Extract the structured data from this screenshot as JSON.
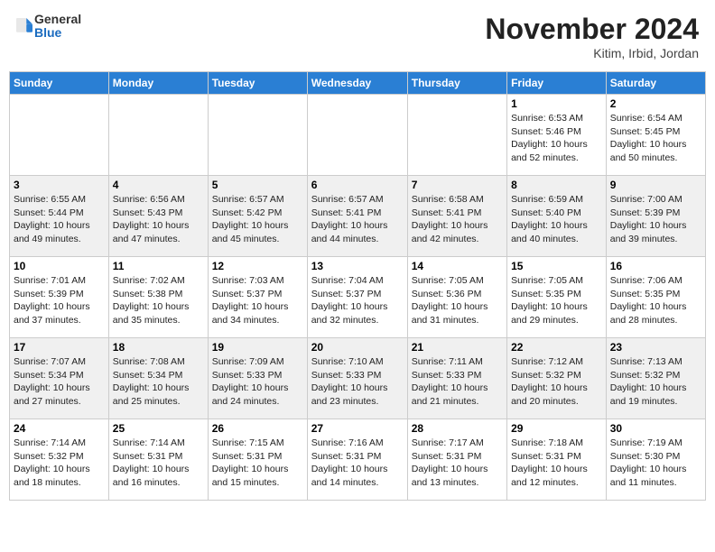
{
  "header": {
    "logo": {
      "general": "General",
      "blue": "Blue"
    },
    "title": "November 2024",
    "location": "Kitim, Irbid, Jordan"
  },
  "weekdays": [
    "Sunday",
    "Monday",
    "Tuesday",
    "Wednesday",
    "Thursday",
    "Friday",
    "Saturday"
  ],
  "weeks": [
    [
      {
        "day": "",
        "info": ""
      },
      {
        "day": "",
        "info": ""
      },
      {
        "day": "",
        "info": ""
      },
      {
        "day": "",
        "info": ""
      },
      {
        "day": "",
        "info": ""
      },
      {
        "day": "1",
        "info": "Sunrise: 6:53 AM\nSunset: 5:46 PM\nDaylight: 10 hours and 52 minutes."
      },
      {
        "day": "2",
        "info": "Sunrise: 6:54 AM\nSunset: 5:45 PM\nDaylight: 10 hours and 50 minutes."
      }
    ],
    [
      {
        "day": "3",
        "info": "Sunrise: 6:55 AM\nSunset: 5:44 PM\nDaylight: 10 hours and 49 minutes."
      },
      {
        "day": "4",
        "info": "Sunrise: 6:56 AM\nSunset: 5:43 PM\nDaylight: 10 hours and 47 minutes."
      },
      {
        "day": "5",
        "info": "Sunrise: 6:57 AM\nSunset: 5:42 PM\nDaylight: 10 hours and 45 minutes."
      },
      {
        "day": "6",
        "info": "Sunrise: 6:57 AM\nSunset: 5:41 PM\nDaylight: 10 hours and 44 minutes."
      },
      {
        "day": "7",
        "info": "Sunrise: 6:58 AM\nSunset: 5:41 PM\nDaylight: 10 hours and 42 minutes."
      },
      {
        "day": "8",
        "info": "Sunrise: 6:59 AM\nSunset: 5:40 PM\nDaylight: 10 hours and 40 minutes."
      },
      {
        "day": "9",
        "info": "Sunrise: 7:00 AM\nSunset: 5:39 PM\nDaylight: 10 hours and 39 minutes."
      }
    ],
    [
      {
        "day": "10",
        "info": "Sunrise: 7:01 AM\nSunset: 5:39 PM\nDaylight: 10 hours and 37 minutes."
      },
      {
        "day": "11",
        "info": "Sunrise: 7:02 AM\nSunset: 5:38 PM\nDaylight: 10 hours and 35 minutes."
      },
      {
        "day": "12",
        "info": "Sunrise: 7:03 AM\nSunset: 5:37 PM\nDaylight: 10 hours and 34 minutes."
      },
      {
        "day": "13",
        "info": "Sunrise: 7:04 AM\nSunset: 5:37 PM\nDaylight: 10 hours and 32 minutes."
      },
      {
        "day": "14",
        "info": "Sunrise: 7:05 AM\nSunset: 5:36 PM\nDaylight: 10 hours and 31 minutes."
      },
      {
        "day": "15",
        "info": "Sunrise: 7:05 AM\nSunset: 5:35 PM\nDaylight: 10 hours and 29 minutes."
      },
      {
        "day": "16",
        "info": "Sunrise: 7:06 AM\nSunset: 5:35 PM\nDaylight: 10 hours and 28 minutes."
      }
    ],
    [
      {
        "day": "17",
        "info": "Sunrise: 7:07 AM\nSunset: 5:34 PM\nDaylight: 10 hours and 27 minutes."
      },
      {
        "day": "18",
        "info": "Sunrise: 7:08 AM\nSunset: 5:34 PM\nDaylight: 10 hours and 25 minutes."
      },
      {
        "day": "19",
        "info": "Sunrise: 7:09 AM\nSunset: 5:33 PM\nDaylight: 10 hours and 24 minutes."
      },
      {
        "day": "20",
        "info": "Sunrise: 7:10 AM\nSunset: 5:33 PM\nDaylight: 10 hours and 23 minutes."
      },
      {
        "day": "21",
        "info": "Sunrise: 7:11 AM\nSunset: 5:33 PM\nDaylight: 10 hours and 21 minutes."
      },
      {
        "day": "22",
        "info": "Sunrise: 7:12 AM\nSunset: 5:32 PM\nDaylight: 10 hours and 20 minutes."
      },
      {
        "day": "23",
        "info": "Sunrise: 7:13 AM\nSunset: 5:32 PM\nDaylight: 10 hours and 19 minutes."
      }
    ],
    [
      {
        "day": "24",
        "info": "Sunrise: 7:14 AM\nSunset: 5:32 PM\nDaylight: 10 hours and 18 minutes."
      },
      {
        "day": "25",
        "info": "Sunrise: 7:14 AM\nSunset: 5:31 PM\nDaylight: 10 hours and 16 minutes."
      },
      {
        "day": "26",
        "info": "Sunrise: 7:15 AM\nSunset: 5:31 PM\nDaylight: 10 hours and 15 minutes."
      },
      {
        "day": "27",
        "info": "Sunrise: 7:16 AM\nSunset: 5:31 PM\nDaylight: 10 hours and 14 minutes."
      },
      {
        "day": "28",
        "info": "Sunrise: 7:17 AM\nSunset: 5:31 PM\nDaylight: 10 hours and 13 minutes."
      },
      {
        "day": "29",
        "info": "Sunrise: 7:18 AM\nSunset: 5:31 PM\nDaylight: 10 hours and 12 minutes."
      },
      {
        "day": "30",
        "info": "Sunrise: 7:19 AM\nSunset: 5:30 PM\nDaylight: 10 hours and 11 minutes."
      }
    ]
  ]
}
